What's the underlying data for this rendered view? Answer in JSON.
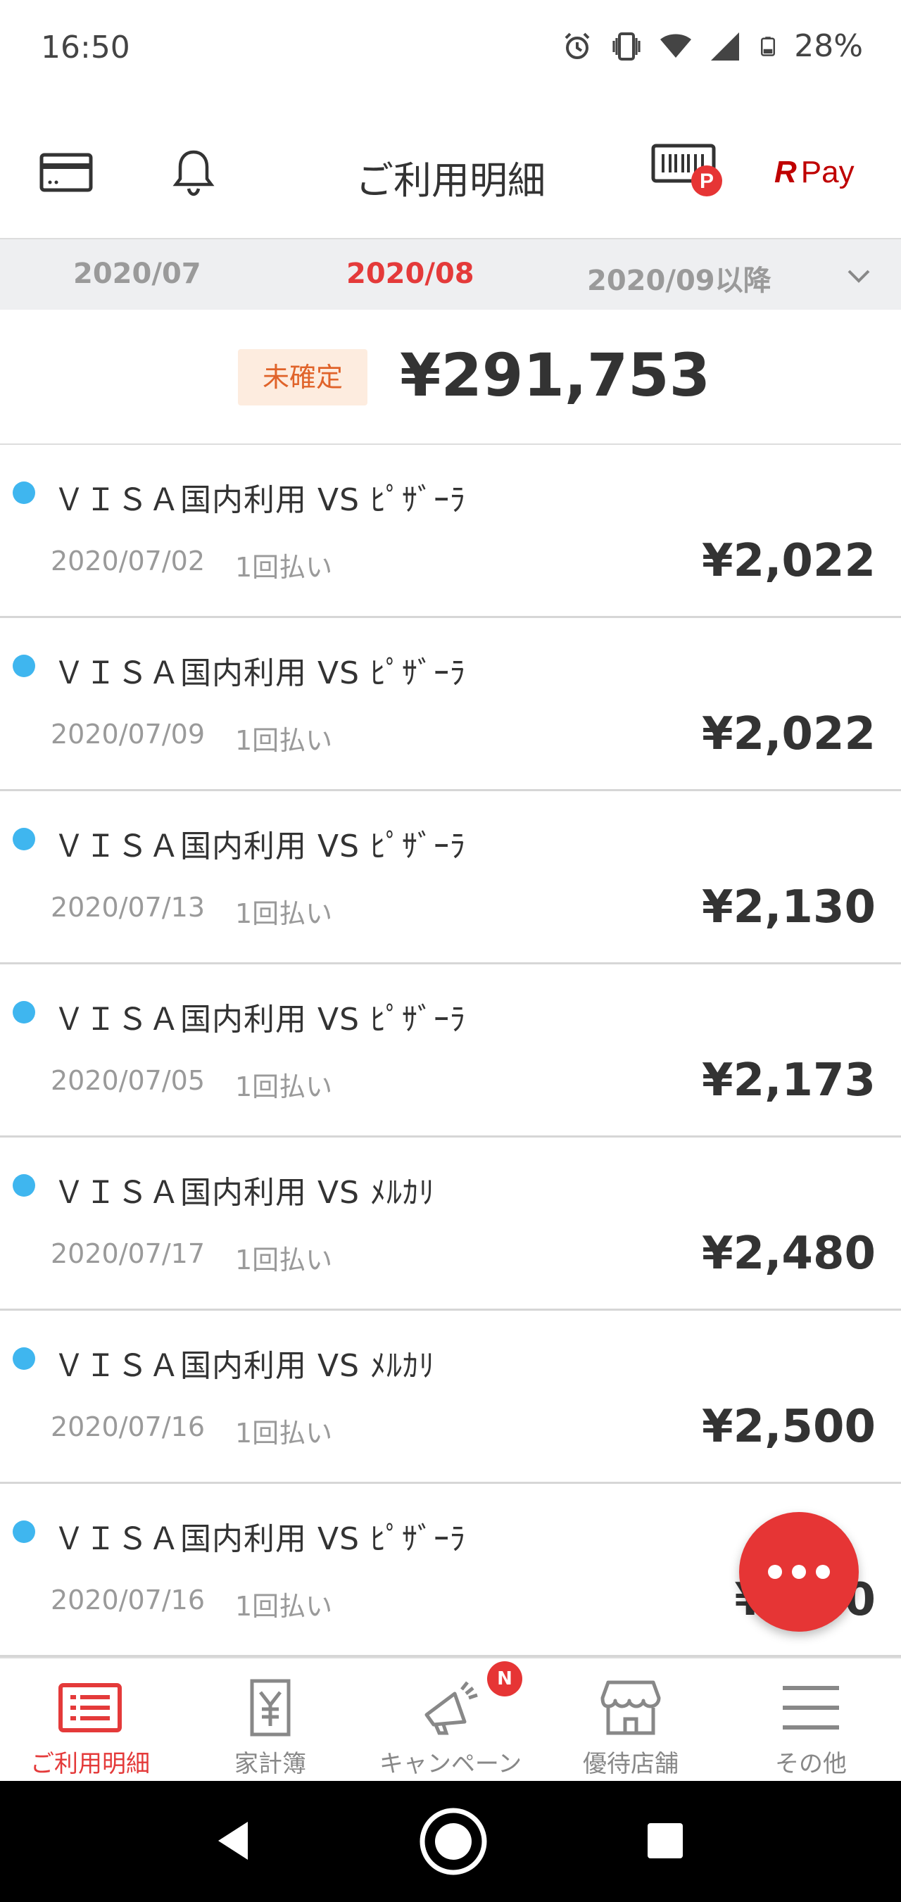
{
  "status_bar": {
    "time": "16:50",
    "battery": "28%",
    "icons": [
      "alarm-icon",
      "vibrate-icon",
      "wifi-icon",
      "signal-icon",
      "battery-icon"
    ]
  },
  "header": {
    "title": "ご利用明細",
    "left_icons": [
      "card-icon",
      "bell-icon"
    ],
    "right_icons": [
      "barcode-point-icon"
    ],
    "rpay_r": "R",
    "rpay_pay": "Pay"
  },
  "months": {
    "prev": "2020/07",
    "current": "2020/08",
    "next": "2020/09以降"
  },
  "total": {
    "badge": "未確定",
    "amount": "¥291,753"
  },
  "transactions": [
    {
      "title": "ＶＩＳＡ国内利用 VS ﾋﾟｻﾞｰﾗ",
      "date": "2020/07/02",
      "plan": "1回払い",
      "amount": "¥2,022"
    },
    {
      "title": "ＶＩＳＡ国内利用 VS ﾋﾟｻﾞｰﾗ",
      "date": "2020/07/09",
      "plan": "1回払い",
      "amount": "¥2,022"
    },
    {
      "title": "ＶＩＳＡ国内利用 VS ﾋﾟｻﾞｰﾗ",
      "date": "2020/07/13",
      "plan": "1回払い",
      "amount": "¥2,130"
    },
    {
      "title": "ＶＩＳＡ国内利用 VS ﾋﾟｻﾞｰﾗ",
      "date": "2020/07/05",
      "plan": "1回払い",
      "amount": "¥2,173"
    },
    {
      "title": "ＶＩＳＡ国内利用 VS ﾒﾙｶﾘ",
      "date": "2020/07/17",
      "plan": "1回払い",
      "amount": "¥2,480"
    },
    {
      "title": "ＶＩＳＡ国内利用 VS ﾒﾙｶﾘ",
      "date": "2020/07/16",
      "plan": "1回払い",
      "amount": "¥2,500"
    },
    {
      "title": "ＶＩＳＡ国内利用 VS ﾋﾟｻﾞｰﾗ",
      "date": "2020/07/16",
      "plan": "1回払い",
      "amount": "¥2,‥0"
    }
  ],
  "fab": {
    "icon": "more-dots-icon"
  },
  "bottom_nav": [
    {
      "label": "ご利用明細",
      "icon": "statement-list-icon",
      "active": true
    },
    {
      "label": "家計簿",
      "icon": "household-book-icon",
      "active": false
    },
    {
      "label": "キャンペーン",
      "icon": "megaphone-icon",
      "active": false,
      "badge": "N"
    },
    {
      "label": "優待店舗",
      "icon": "shop-icon",
      "active": false
    },
    {
      "label": "その他",
      "icon": "menu-icon",
      "active": false
    }
  ],
  "colors": {
    "accent_red": "#e43a3a",
    "rakuten_red": "#bf0000",
    "dot_blue": "#3fb6ef",
    "badge_bg": "#fdecdf",
    "badge_text": "#e0632a"
  }
}
